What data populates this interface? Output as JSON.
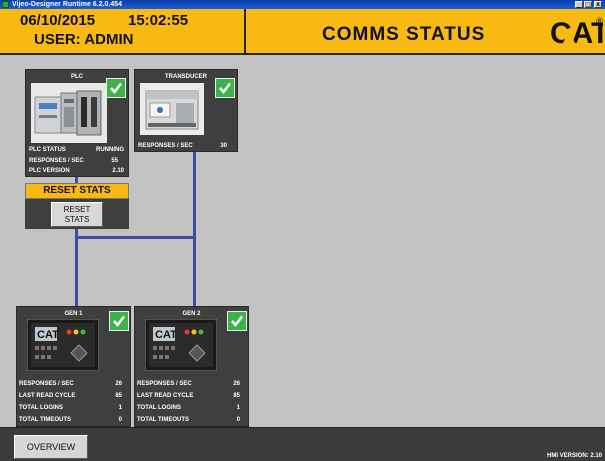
{
  "window": {
    "title": "Vijeo-Designer Runtime 6.2.0.454",
    "minimize": "_",
    "maximize": "□",
    "close": "x"
  },
  "header": {
    "date": "06/10/2015",
    "time": "15:02:55",
    "user": "USER: ADMIN",
    "title": "COMMS STATUS",
    "logo_text": "CAT",
    "logo_mark": "®",
    "bg_color": "#f8ba12"
  },
  "plc": {
    "title": "PLC",
    "status_icon": "check-icon",
    "status_label": "PLC STATUS",
    "status_value": "RUNNING",
    "responses_label": "RESPONSES / SEC",
    "responses_value": "55",
    "version_label": "PLC VERSION",
    "version_value": "2.10"
  },
  "transducer": {
    "title": "TRANSDUCER",
    "status_icon": "check-icon",
    "responses_label": "RESPONSES / SEC",
    "responses_value": "30"
  },
  "reset": {
    "label": "RESET STATS",
    "button_line1": "RESET",
    "button_line2": "STATS"
  },
  "generators": [
    {
      "title": "GEN 1",
      "stats": [
        {
          "label": "RESPONSES / SEC",
          "value": "26"
        },
        {
          "label": "LAST READ CYCLE",
          "value": "85"
        },
        {
          "label": "TOTAL LOGINS",
          "value": "1"
        },
        {
          "label": "TOTAL TIMEOUTS",
          "value": "0"
        }
      ]
    },
    {
      "title": "GEN 2",
      "stats": [
        {
          "label": "RESPONSES / SEC",
          "value": "26"
        },
        {
          "label": "LAST READ CYCLE",
          "value": "85"
        },
        {
          "label": "TOTAL LOGINS",
          "value": "1"
        },
        {
          "label": "TOTAL TIMEOUTS",
          "value": "0"
        }
      ]
    }
  ],
  "footer": {
    "overview": "OVERVIEW",
    "hmi_version": "HMI VERSION: 2.10"
  },
  "colors": {
    "ok_green": "#3cb34a",
    "link_blue": "#3a4ea8",
    "panel_dark": "#3f3f3f"
  }
}
